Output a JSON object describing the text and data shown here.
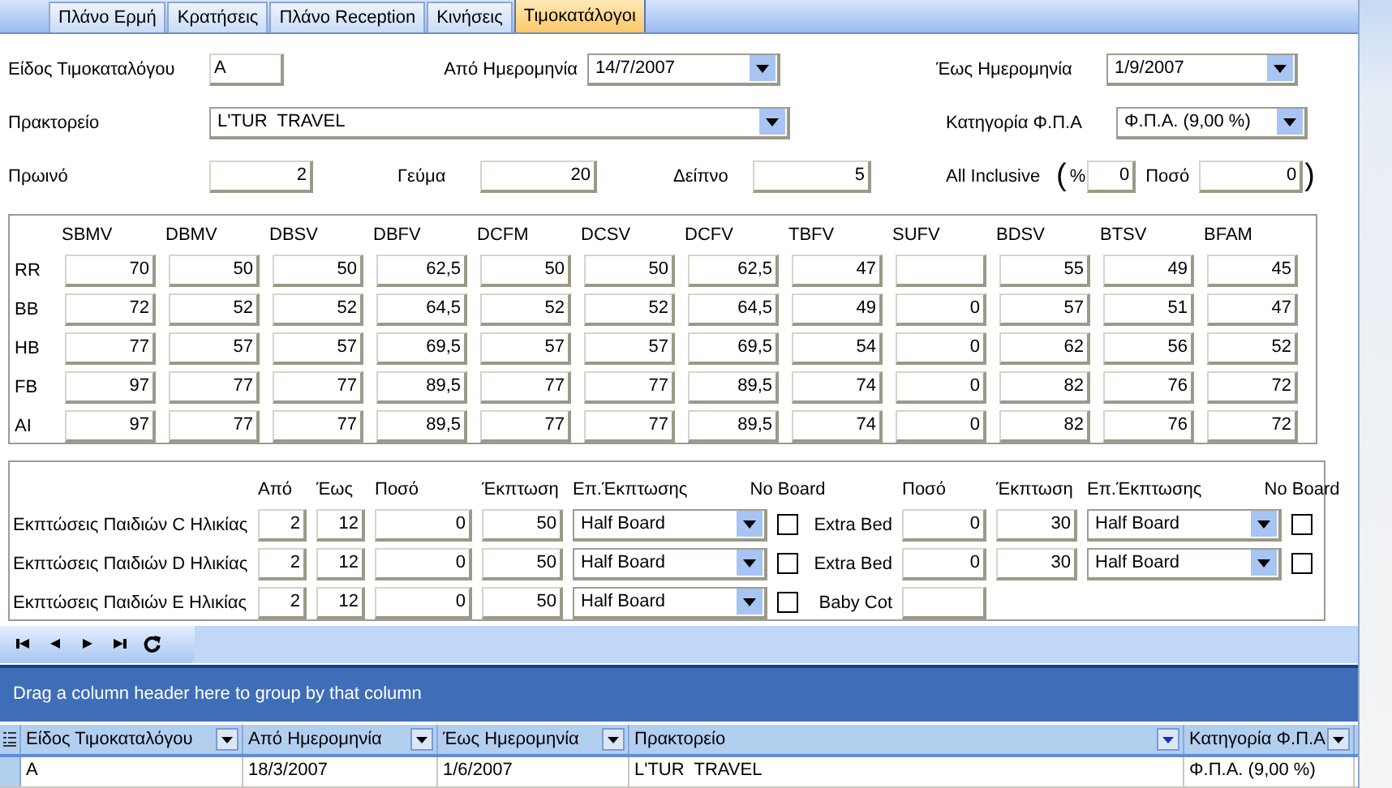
{
  "tabs": [
    {
      "label": "Πλάνο Ερμή",
      "selected": false
    },
    {
      "label": "Κρατήσεις",
      "selected": false
    },
    {
      "label": "Πλάνο Reception",
      "selected": false
    },
    {
      "label": "Κινήσεις",
      "selected": false
    },
    {
      "label": "Τιμοκατάλογοι",
      "selected": true
    }
  ],
  "header_form": {
    "price_list_type": {
      "label": "Είδος Τιμοκαταλόγου",
      "value": "A"
    },
    "from_date": {
      "label": "Από Ημερομηνία",
      "value": "14/7/2007"
    },
    "to_date": {
      "label": "Έως Ημερομηνία",
      "value": "1/9/2007"
    },
    "agency": {
      "label": "Πρακτορείο",
      "value": "L'TUR  TRAVEL"
    },
    "vat_category": {
      "label": "Κατηγορία Φ.Π.Α",
      "value": "Φ.Π.Α. (9,00 %)"
    },
    "breakfast": {
      "label": "Πρωινό",
      "value": "2"
    },
    "lunch": {
      "label": "Γεύμα",
      "value": "20"
    },
    "dinner": {
      "label": "Δείπνο",
      "value": "5"
    },
    "all_inclusive": {
      "label": "All Inclusive",
      "open_paren": "(",
      "percent_label": "%",
      "percent": "0",
      "amount_label": "Ποσό",
      "amount": "0",
      "close_paren": ")"
    }
  },
  "price_grid": {
    "columns": [
      "SBMV",
      "DBMV",
      "DBSV",
      "DBFV",
      "DCFM",
      "DCSV",
      "DCFV",
      "TBFV",
      "SUFV",
      "BDSV",
      "BTSV",
      "BFAM"
    ],
    "rows": [
      {
        "label": "RR",
        "cells": [
          {
            "kind": "number",
            "value": "70"
          },
          {
            "kind": "number",
            "value": "50"
          },
          {
            "kind": "number",
            "value": "50"
          },
          {
            "kind": "number",
            "value": "62,5"
          },
          {
            "kind": "number",
            "value": "50"
          },
          {
            "kind": "number",
            "value": "50"
          },
          {
            "kind": "number",
            "value": "62,5"
          },
          {
            "kind": "number",
            "value": "47"
          },
          {
            "kind": "blank"
          },
          {
            "kind": "number",
            "value": "55"
          },
          {
            "kind": "number",
            "value": "49"
          },
          {
            "kind": "number",
            "value": "45"
          }
        ]
      },
      {
        "label": "BB",
        "cells": [
          {
            "kind": "number",
            "value": "72"
          },
          {
            "kind": "number",
            "value": "52"
          },
          {
            "kind": "number",
            "value": "52"
          },
          {
            "kind": "number",
            "value": "64,5"
          },
          {
            "kind": "number",
            "value": "52"
          },
          {
            "kind": "number",
            "value": "52"
          },
          {
            "kind": "number",
            "value": "64,5"
          },
          {
            "kind": "number",
            "value": "49"
          },
          {
            "kind": "number",
            "value": "0"
          },
          {
            "kind": "number",
            "value": "57"
          },
          {
            "kind": "number",
            "value": "51"
          },
          {
            "kind": "number",
            "value": "47"
          }
        ]
      },
      {
        "label": "HB",
        "cells": [
          {
            "kind": "number",
            "value": "77"
          },
          {
            "kind": "number",
            "value": "57"
          },
          {
            "kind": "number",
            "value": "57"
          },
          {
            "kind": "number",
            "value": "69,5"
          },
          {
            "kind": "number",
            "value": "57"
          },
          {
            "kind": "number",
            "value": "57"
          },
          {
            "kind": "number",
            "value": "69,5"
          },
          {
            "kind": "number",
            "value": "54"
          },
          {
            "kind": "number",
            "value": "0"
          },
          {
            "kind": "number",
            "value": "62"
          },
          {
            "kind": "number",
            "value": "56"
          },
          {
            "kind": "number",
            "value": "52"
          }
        ]
      },
      {
        "label": "FB",
        "cells": [
          {
            "kind": "number",
            "value": "97"
          },
          {
            "kind": "number",
            "value": "77"
          },
          {
            "kind": "number",
            "value": "77"
          },
          {
            "kind": "number",
            "value": "89,5"
          },
          {
            "kind": "number",
            "value": "77"
          },
          {
            "kind": "number",
            "value": "77"
          },
          {
            "kind": "number",
            "value": "89,5"
          },
          {
            "kind": "number",
            "value": "74"
          },
          {
            "kind": "number",
            "value": "0"
          },
          {
            "kind": "number",
            "value": "82"
          },
          {
            "kind": "number",
            "value": "76"
          },
          {
            "kind": "number",
            "value": "72"
          }
        ]
      },
      {
        "label": "AI",
        "cells": [
          {
            "kind": "number",
            "value": "97"
          },
          {
            "kind": "number",
            "value": "77"
          },
          {
            "kind": "number",
            "value": "77"
          },
          {
            "kind": "number",
            "value": "89,5"
          },
          {
            "kind": "number",
            "value": "77"
          },
          {
            "kind": "number",
            "value": "77"
          },
          {
            "kind": "number",
            "value": "89,5"
          },
          {
            "kind": "number",
            "value": "74"
          },
          {
            "kind": "number",
            "value": "0"
          },
          {
            "kind": "number",
            "value": "82"
          },
          {
            "kind": "number",
            "value": "76"
          },
          {
            "kind": "number",
            "value": "72"
          }
        ]
      }
    ]
  },
  "child_discounts": {
    "headers": [
      "Από",
      "Έως",
      "Ποσό",
      "Έκπτωση",
      "Επ.Έκπτωσης",
      "No Board",
      "Ποσό",
      "Έκπτωση",
      "Επ.Έκπτωσης",
      "No Board"
    ],
    "rows": [
      {
        "label": "Εκπτώσεις Παιδιών C Ηλικίας",
        "from": "2",
        "to": "12",
        "amount": "0",
        "discount": "50",
        "discount_type": "Half Board",
        "no_board": false,
        "extra": {
          "label": "Extra Bed",
          "amount": "0",
          "discount": "30",
          "discount_type": "Half Board",
          "no_board": false
        }
      },
      {
        "label": "Εκπτώσεις Παιδιών D Ηλικίας",
        "from": "2",
        "to": "12",
        "amount": "0",
        "discount": "50",
        "discount_type": "Half Board",
        "no_board": false,
        "extra": {
          "label": "Extra Bed",
          "amount": "0",
          "discount": "30",
          "discount_type": "Half Board",
          "no_board": false
        }
      },
      {
        "label": "Εκπτώσεις Παιδιών E Ηλικίας",
        "from": "2",
        "to": "12",
        "amount": "0",
        "discount": "50",
        "discount_type": "Half Board",
        "no_board": false,
        "extra": {
          "label": "Baby Cot"
        }
      }
    ]
  },
  "grid": {
    "group_panel_text": "Drag a column header here to group by that column",
    "columns": [
      "Είδος Τιμοκαταλόγου",
      "Από Ημερομηνία",
      "Έως Ημερομηνία",
      "Πρακτορείο",
      "Κατηγορία Φ.Π.Α"
    ],
    "rows": [
      [
        "A",
        "18/3/2007",
        "1/6/2007",
        "L'TUR  TRAVEL",
        "Φ.Π.Α. (9,00 %)"
      ]
    ]
  }
}
